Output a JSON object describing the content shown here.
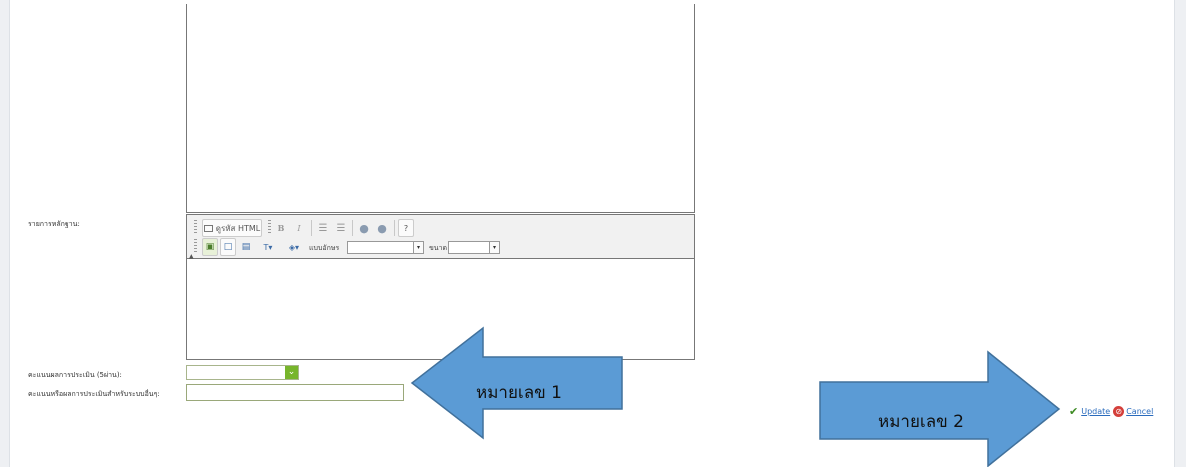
{
  "form": {
    "evidence_label": "รายการหลักฐาน:",
    "score_label": "คะแนนผลการประเมิน (5ผ่าน):",
    "other_score_label": "คะแนนหรือผลการประเมินสำหรับระบบอื่นๆ:",
    "score_value": "",
    "other_score_value": ""
  },
  "toolbar": {
    "html_button": "ดูรหัส HTML",
    "bold": "B",
    "italic": "I",
    "font_label": "แบบอักษร",
    "size_label": "ขนาด",
    "font_value": "",
    "size_value": ""
  },
  "annotations": {
    "arrow1": "หมายเลข 1",
    "arrow2": "หมายเลข 2"
  },
  "actions": {
    "update": "Update",
    "cancel": "Cancel"
  },
  "colors": {
    "arrow_fill": "#5b9bd5",
    "arrow_stroke": "#41719c",
    "select_accent": "#77b52b",
    "link": "#2a6bbd"
  }
}
